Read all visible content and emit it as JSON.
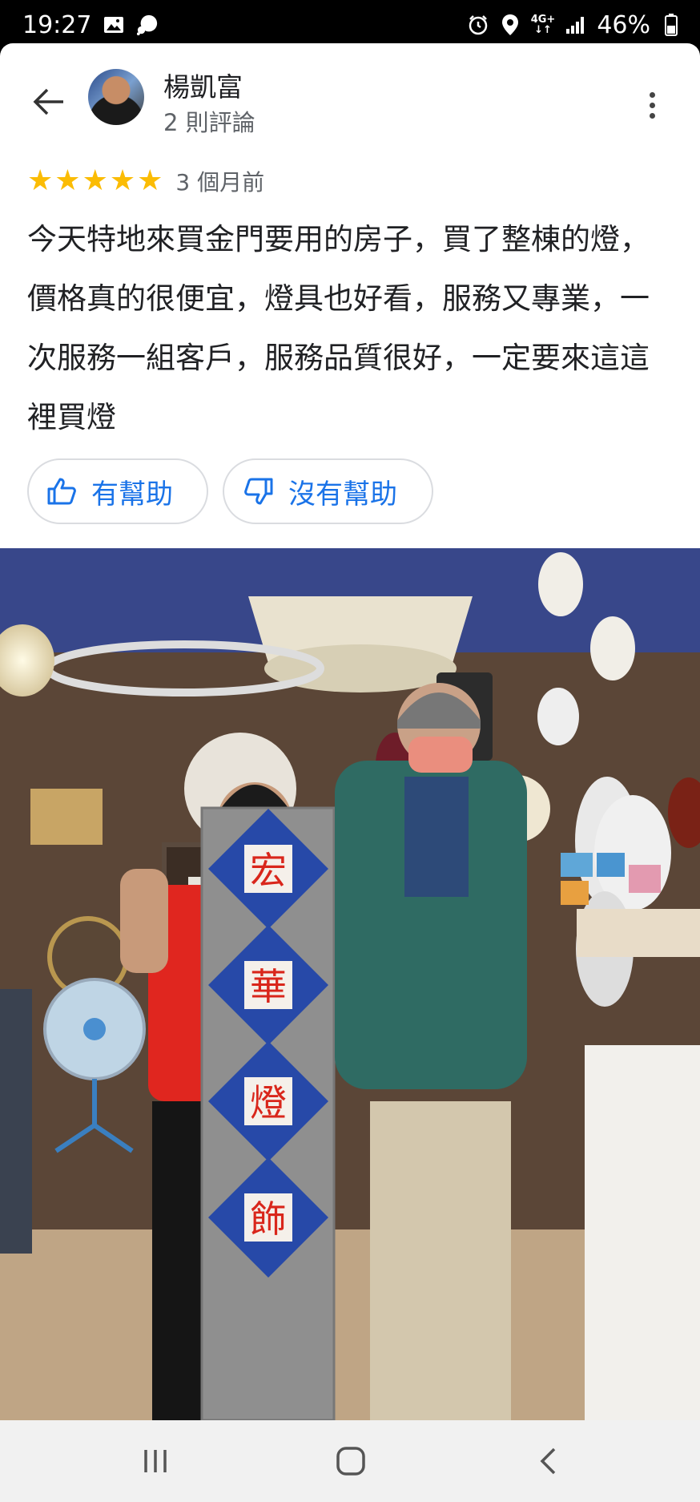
{
  "status_bar": {
    "time": "19:27",
    "network": "4G+",
    "battery": "46%"
  },
  "review": {
    "user_name": "楊凱富",
    "user_review_count": "2 則評論",
    "rating": 5,
    "time_ago": "3 個月前",
    "text": "今天特地來買金門要用的房子，買了整棟的燈，價格真的很便宜，燈具也好看，服務又專業，一次服務一組客戶，服務品質很好，一定要來這這裡買燈",
    "helpful_label": "有幫助",
    "unhelpful_label": "沒有幫助"
  },
  "photo": {
    "sign_chars": [
      "宏",
      "華",
      "燈",
      "飾"
    ]
  },
  "colors": {
    "accent": "#1a73e8",
    "star": "#fbbc04"
  }
}
